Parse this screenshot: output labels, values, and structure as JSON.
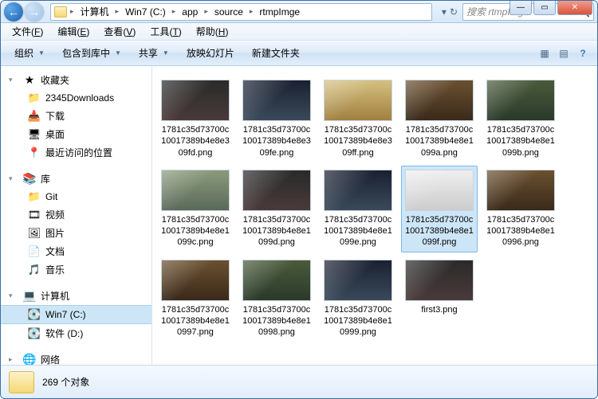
{
  "window": {
    "title": "rtmpImge"
  },
  "titlebar": {
    "min": "—",
    "max": "▭",
    "close": "✕"
  },
  "nav": {
    "back": "←",
    "forward": "→",
    "refresh": "↻",
    "dropdown": "▾"
  },
  "breadcrumb": {
    "sep": "▸",
    "items": [
      "计算机",
      "Win7 (C:)",
      "app",
      "source",
      "rtmpImge"
    ]
  },
  "search": {
    "placeholder": "搜索 rtmpImge",
    "icon": "🔍"
  },
  "menu": {
    "file": {
      "label": "文件",
      "key": "F"
    },
    "edit": {
      "label": "编辑",
      "key": "E"
    },
    "view": {
      "label": "查看",
      "key": "V"
    },
    "tools": {
      "label": "工具",
      "key": "T"
    },
    "help": {
      "label": "帮助",
      "key": "H"
    }
  },
  "toolbar": {
    "organize": "组织",
    "includeLib": "包含到库中",
    "share": "共享",
    "slideshow": "放映幻灯片",
    "newfolder": "新建文件夹",
    "viewmode_icon": "▦",
    "help_icon": "?"
  },
  "sidebar": {
    "favorites": {
      "label": "收藏夹",
      "icon": "★",
      "items": [
        {
          "label": "2345Downloads",
          "icon": "📁"
        },
        {
          "label": "下载",
          "icon": "📥"
        },
        {
          "label": "桌面",
          "icon": "🖥"
        },
        {
          "label": "最近访问的位置",
          "icon": "📍"
        }
      ]
    },
    "libraries": {
      "label": "库",
      "icon": "📚",
      "items": [
        {
          "label": "Git",
          "icon": "📁"
        },
        {
          "label": "视频",
          "icon": "🎞"
        },
        {
          "label": "图片",
          "icon": "🖼"
        },
        {
          "label": "文档",
          "icon": "📄"
        },
        {
          "label": "音乐",
          "icon": "🎵"
        }
      ]
    },
    "computer": {
      "label": "计算机",
      "icon": "💻",
      "items": [
        {
          "label": "Win7 (C:)",
          "icon": "💽",
          "selected": true
        },
        {
          "label": "软件 (D:)",
          "icon": "💽"
        }
      ]
    },
    "network": {
      "label": "网络",
      "icon": "🌐"
    }
  },
  "files": [
    {
      "name": "1781c35d73700c10017389b4e8e309fd.png",
      "t": "t0"
    },
    {
      "name": "1781c35d73700c10017389b4e8e309fe.png",
      "t": "t1"
    },
    {
      "name": "1781c35d73700c10017389b4e8e309ff.png",
      "t": "t2"
    },
    {
      "name": "1781c35d73700c10017389b4e8e1099a.png",
      "t": "t3"
    },
    {
      "name": "1781c35d73700c10017389b4e8e1099b.png",
      "t": "t4"
    },
    {
      "name": "1781c35d73700c10017389b4e8e1099c.png",
      "t": "t5"
    },
    {
      "name": "1781c35d73700c10017389b4e8e1099d.png",
      "t": "t0"
    },
    {
      "name": "1781c35d73700c10017389b4e8e1099e.png",
      "t": "t1"
    },
    {
      "name": "1781c35d73700c10017389b4e8e1099f.png",
      "t": "t6",
      "selected": true
    },
    {
      "name": "1781c35d73700c10017389b4e8e10996.png",
      "t": "t3"
    },
    {
      "name": "1781c35d73700c10017389b4e8e10997.png",
      "t": "t3"
    },
    {
      "name": "1781c35d73700c10017389b4e8e10998.png",
      "t": "t4"
    },
    {
      "name": "1781c35d73700c10017389b4e8e10999.png",
      "t": "t1"
    },
    {
      "name": "first3.png",
      "t": "t0"
    }
  ],
  "status": {
    "count": "269 个对象"
  }
}
